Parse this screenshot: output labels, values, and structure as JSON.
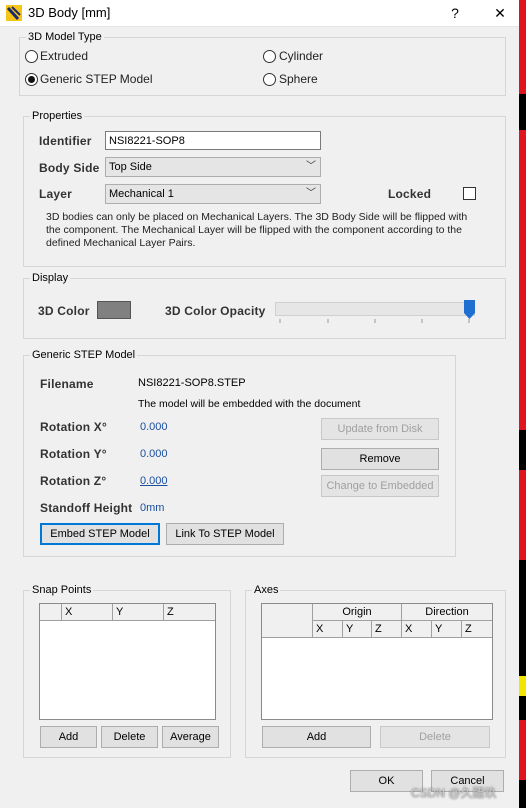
{
  "title": "3D Body [mm]",
  "titlebar": {
    "help": "?",
    "close": "✕"
  },
  "model_type": {
    "group_title": "3D Model Type",
    "options": [
      {
        "label": "Extruded",
        "selected": false
      },
      {
        "label": "Cylinder",
        "selected": false
      },
      {
        "label": "Generic STEP Model",
        "selected": true
      },
      {
        "label": "Sphere",
        "selected": false
      }
    ]
  },
  "properties": {
    "group_title": "Properties",
    "identifier_label": "Identifier",
    "identifier_value": "NSI8221-SOP8",
    "body_side_label": "Body Side",
    "body_side_value": "Top Side",
    "layer_label": "Layer",
    "layer_value": "Mechanical 1",
    "locked_label": "Locked",
    "locked": false,
    "note_lines": [
      "3D bodies can only be placed on Mechanical Layers. The 3D Body Side will be flipped with",
      "the component. The Mechanical Layer will be flipped with the component according to the",
      "defined Mechanical Layer Pairs."
    ]
  },
  "display": {
    "group_title": "Display",
    "color_label": "3D Color",
    "color_value": "#808080",
    "opacity_label": "3D Color Opacity",
    "opacity_level": 1.0
  },
  "step": {
    "group_title": "Generic STEP Model",
    "filename_label": "Filename",
    "filename_value": "NSI8221-SOP8.STEP",
    "embed_note": "The model will be embedded with the document",
    "rot_x_label": "Rotation X°",
    "rot_x_value": "0.000",
    "rot_y_label": "Rotation Y°",
    "rot_y_value": "0.000",
    "rot_z_label": "Rotation Z°",
    "rot_z_value": "0.000",
    "standoff_label": "Standoff Height",
    "standoff_value": "0mm",
    "update_btn": "Update from Disk",
    "remove_btn": "Remove",
    "change_btn": "Change to Embedded",
    "embed_btn": "Embed STEP Model",
    "link_btn": "Link To STEP Model"
  },
  "snap": {
    "group_title": "Snap Points",
    "columns": [
      "X",
      "Y",
      "Z"
    ],
    "add": "Add",
    "delete": "Delete",
    "average": "Average"
  },
  "axes": {
    "group_title": "Axes",
    "origin_header": "Origin",
    "direction_header": "Direction",
    "columns": [
      "X",
      "Y",
      "Z",
      "X",
      "Y",
      "Z"
    ],
    "add": "Add",
    "delete": "Delete"
  },
  "footer": {
    "ok": "OK",
    "cancel": "Cancel",
    "watermark": "CSDN @久醋玖"
  },
  "colors": {
    "accent": "#0078d7",
    "slider_thumb": "#1e6fd0",
    "side_red": "#e0141e",
    "side_yellow": "#f2e600"
  }
}
